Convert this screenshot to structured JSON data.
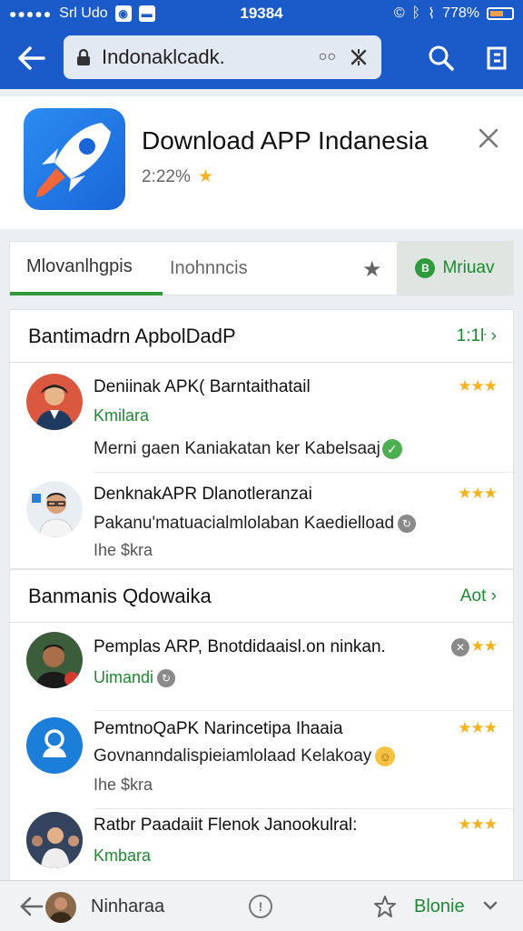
{
  "status_bar": {
    "carrier": "Srl Udo",
    "time": "19384",
    "battery": "778%"
  },
  "toolbar": {
    "url": "Indonaklcadk."
  },
  "app": {
    "title": "Download APP Indanesia",
    "rating": "2:22%"
  },
  "tabs": {
    "active": "Mlovanlhgpis",
    "second": "Inohnncis",
    "right_button": "Mriuav"
  },
  "sections": [
    {
      "title": "Bantimadrn ApbolDadP",
      "link": "1:1ŀ"
    },
    {
      "title": "Banmanis Qdowaika",
      "link": "Aot"
    }
  ],
  "items": [
    {
      "title": "Deniinak APK( Barntaithatail",
      "subtitle": "Kmilara",
      "desc": "Merni gaen Kaniakatan ker Kabelsaaj",
      "rating": "★★★",
      "avatar": "man-suit",
      "desc_icon": "check-green-icon"
    },
    {
      "title": "DenknakAPR Dlanotleranzai",
      "subtitle": "Ihe $kra",
      "desc": "Pakanu'matuacialmlolaban Kaedielload",
      "rating": "★★★",
      "avatar": "man-glasses",
      "desc_icon": "info-grey-icon"
    },
    {
      "title": "Pemplas ARP, Bnotdidaaisl.on ninkan.",
      "subtitle": "Uimandi",
      "desc": "",
      "rating": "★★",
      "avatar": "man-smiling",
      "desc_icon": "info-grey-icon"
    },
    {
      "title": "PemtnoQaPK Narincetipa Ihaaia",
      "subtitle": "Ihe $kra",
      "desc": "Govnanndalispieiamlolaad Kelakoay",
      "rating": "★★★",
      "avatar": "person-blue",
      "desc_icon": "smile-icon"
    },
    {
      "title": "Ratbr Paadaiit Flenok Janookulral:",
      "subtitle": "Kmbara",
      "desc": "",
      "rating": "★★★",
      "avatar": "group",
      "desc_icon": ""
    }
  ],
  "bottom_bar": {
    "name": "Ninharaa",
    "action": "Blonie"
  },
  "colors": {
    "primary": "#1a5bc9",
    "accent_green": "#2f9a3c",
    "star": "#f5b21d"
  }
}
